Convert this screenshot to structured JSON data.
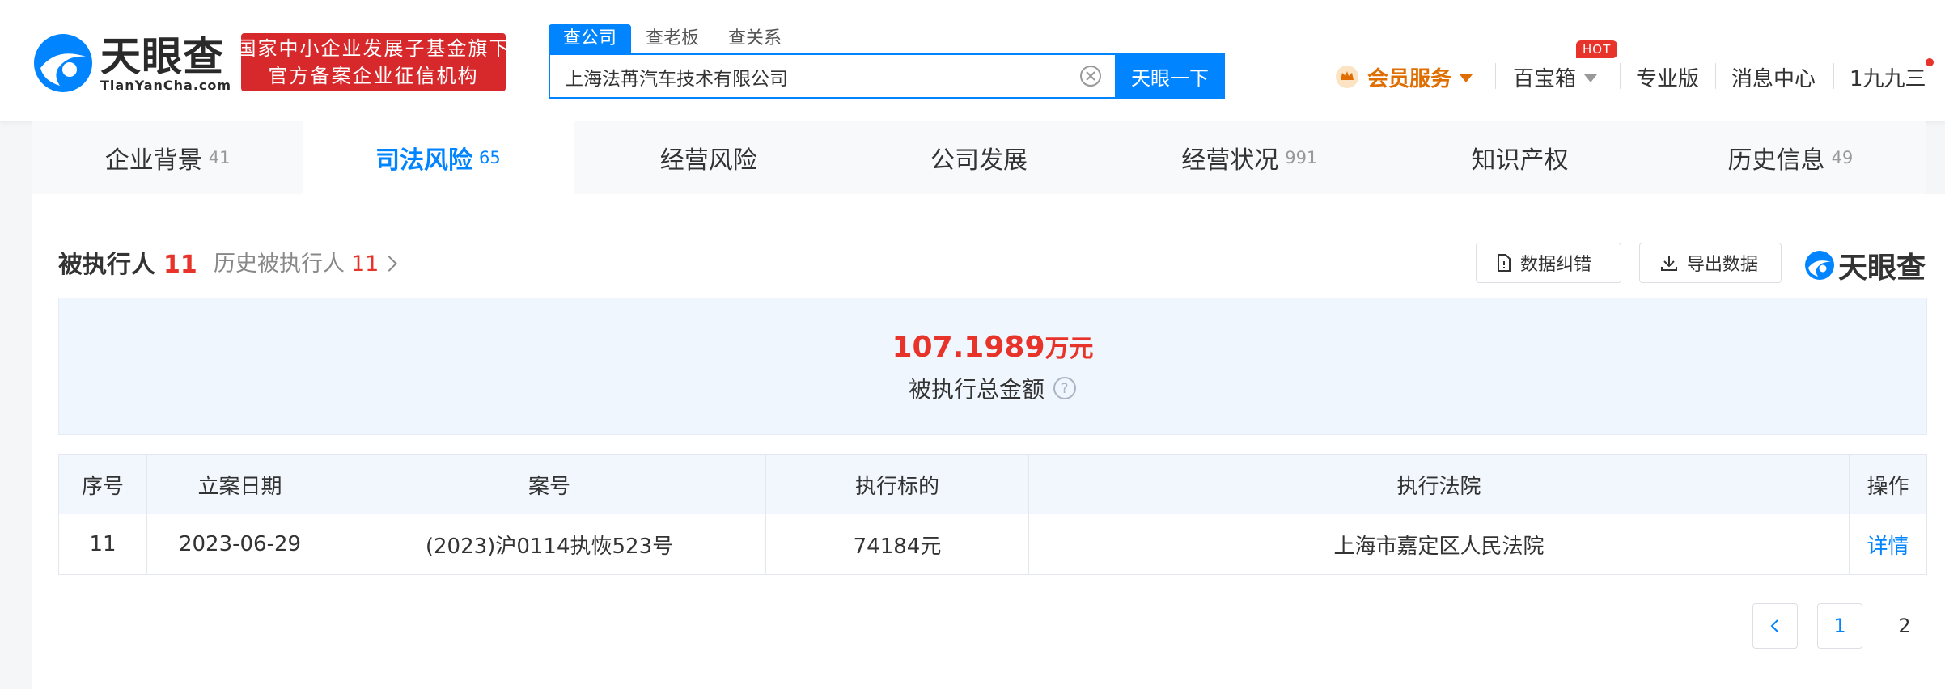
{
  "brand": {
    "logo_text": "天眼查",
    "logo_domain": "TianYanCha.com",
    "badge_line1": "国家中小企业发展子基金旗下",
    "badge_line2": "官方备案企业征信机构",
    "brand_color": "#0084ff",
    "accent_red": "#e8332a"
  },
  "search": {
    "tabs": [
      "查公司",
      "查老板",
      "查关系"
    ],
    "value": "上海法苒汽车技术有限公司",
    "button": "天眼一下"
  },
  "nav": {
    "vip": "会员服务",
    "baobox": "百宝箱",
    "hot": "HOT",
    "pro": "专业版",
    "messages": "消息中心",
    "user": "1九九三"
  },
  "tabs": [
    {
      "label": "企业背景",
      "count": "41"
    },
    {
      "label": "司法风险",
      "count": "65"
    },
    {
      "label": "经营风险",
      "count": ""
    },
    {
      "label": "公司发展",
      "count": ""
    },
    {
      "label": "经营状况",
      "count": "991"
    },
    {
      "label": "知识产权",
      "count": ""
    },
    {
      "label": "历史信息",
      "count": "49"
    }
  ],
  "section": {
    "title": "被执行人",
    "count": "11",
    "history_label": "历史被执行人",
    "history_count": "11",
    "correct_btn": "数据纠错",
    "export_btn": "导出数据",
    "watermark": "天眼查"
  },
  "summary": {
    "amount": "107.1989",
    "unit": "万元",
    "label": "被执行总金额"
  },
  "table": {
    "headers": [
      "序号",
      "立案日期",
      "案号",
      "执行标的",
      "执行法院",
      "操作"
    ],
    "rows": [
      [
        "11",
        "2023-06-29",
        "(2023)沪0114执恢523号",
        "74184元",
        "上海市嘉定区人民法院",
        "详情"
      ]
    ]
  },
  "pagination": {
    "pages": [
      "1",
      "2"
    ],
    "current": "1"
  }
}
